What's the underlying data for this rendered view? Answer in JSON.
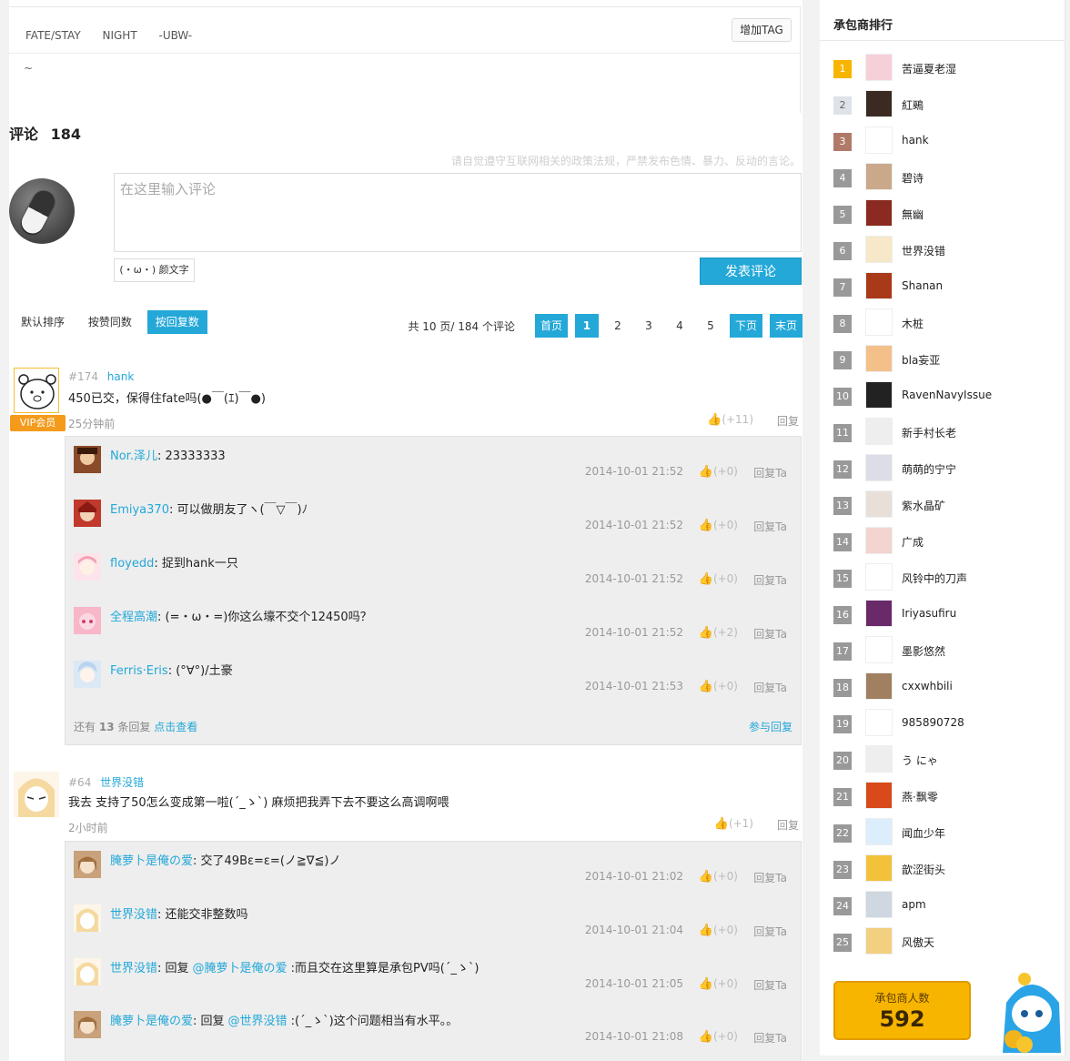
{
  "tags": [
    "FATE/STAY",
    "NIGHT",
    "-UBW-"
  ],
  "add_tag_label": "增加TAG",
  "description": "~",
  "comments_header": {
    "label": "评论",
    "count": "184"
  },
  "policy_notice": "请自觉遵守互联网相关的政策法规，严禁发布色情、暴力、反动的言论。",
  "comment_input": {
    "placeholder": "在这里输入评论"
  },
  "kaomoji_label": "(・ω・) 颜文字",
  "submit_label": "发表评论",
  "sort_tabs": [
    "默认排序",
    "按赞同数",
    "按回复数"
  ],
  "pagination": {
    "summary": "共 10 页/ 184 个评论",
    "first": "首页",
    "pages": [
      "1",
      "2",
      "3",
      "4",
      "5"
    ],
    "next": "下页",
    "last": "末页"
  },
  "comments": [
    {
      "floor": "#174",
      "user": "hank",
      "vip_label": "VIP会员",
      "text": "450已交，保得住fate吗(●￣(ｴ)￣●)",
      "time": "25分钟前",
      "likes": "(+11)",
      "reply_label": "回复",
      "replies": [
        {
          "user": "Nor.泽儿",
          "text": ": 23333333",
          "time": "2014-10-01 21:52",
          "likes": "(+0)",
          "reply_label": "回复Ta"
        },
        {
          "user": "Emiya370",
          "text": ": 可以做朋友了ヽ(￣▽￣)ﾉ",
          "time": "2014-10-01 21:52",
          "likes": "(+0)",
          "reply_label": "回复Ta"
        },
        {
          "user": "floyedd",
          "text": ": 捉到hank一只",
          "time": "2014-10-01 21:52",
          "likes": "(+0)",
          "reply_label": "回复Ta"
        },
        {
          "user": "全程高潮",
          "text": ": (=・ω・=)你这么壕不交个12450吗？",
          "time": "2014-10-01 21:52",
          "likes": "(+2)",
          "reply_label": "回复Ta"
        },
        {
          "user": "Ferris·Eris",
          "text": ": (°∀°)/土豪",
          "time": "2014-10-01 21:53",
          "likes": "(+0)",
          "reply_label": "回复Ta"
        }
      ],
      "more_prefix": "还有",
      "more_count": "13",
      "more_suffix": "条回复",
      "more_link": "点击查看",
      "join_label": "参与回复"
    },
    {
      "floor": "#64",
      "user": "世界没错",
      "text": "我去 支持了50怎么变成第一啦(´_ゝ`) 麻烦把我弄下去不要这么高调啊喂",
      "time": "2小时前",
      "likes": "(+1)",
      "reply_label": "回复",
      "replies": [
        {
          "user": "腌萝卜是俺の爱",
          "text": ": 交了49Bε=ε=(ノ≧∇≦)ノ",
          "time": "2014-10-01 21:02",
          "likes": "(+0)",
          "reply_label": "回复Ta"
        },
        {
          "user": "世界没错",
          "text": ": 还能交非整数吗",
          "time": "2014-10-01 21:04",
          "likes": "(+0)",
          "reply_label": "回复Ta"
        },
        {
          "user": "世界没错",
          "text": ": 回复",
          "mention": "@腌萝卜是俺の爱",
          "text2": " :而且交在这里算是承包PV吗(´_ゝ`)",
          "time": "2014-10-01 21:05",
          "likes": "(+0)",
          "reply_label": "回复Ta"
        },
        {
          "user": "腌萝卜是俺の爱",
          "text": ": 回复",
          "mention": "@世界没错",
          "text2": " :(´_ゝ`)这个问题相当有水平。。",
          "time": "2014-10-01 21:08",
          "likes": "(+0)",
          "reply_label": "回复Ta"
        }
      ]
    }
  ],
  "sidebar": {
    "title": "承包商排行",
    "ranking": [
      {
        "rank": "1",
        "name": "苦逼夏老湿"
      },
      {
        "rank": "2",
        "name": "紅鵐"
      },
      {
        "rank": "3",
        "name": "hank"
      },
      {
        "rank": "4",
        "name": "碧诗"
      },
      {
        "rank": "5",
        "name": "無幽"
      },
      {
        "rank": "6",
        "name": "世界没错"
      },
      {
        "rank": "7",
        "name": "Shanan"
      },
      {
        "rank": "8",
        "name": "木桩"
      },
      {
        "rank": "9",
        "name": "bla妄亚"
      },
      {
        "rank": "10",
        "name": "RavenNavyIssue"
      },
      {
        "rank": "11",
        "name": "新手村长老"
      },
      {
        "rank": "12",
        "name": "萌萌的宁宁"
      },
      {
        "rank": "13",
        "name": "紫水晶矿"
      },
      {
        "rank": "14",
        "name": "广成"
      },
      {
        "rank": "15",
        "name": "风铃中的刀声"
      },
      {
        "rank": "16",
        "name": "Iriyasufiru"
      },
      {
        "rank": "17",
        "name": "墨影悠然"
      },
      {
        "rank": "18",
        "name": "cxxwhbili"
      },
      {
        "rank": "19",
        "name": "985890728"
      },
      {
        "rank": "20",
        "name": "う にゃ"
      },
      {
        "rank": "21",
        "name": "燕·飘零"
      },
      {
        "rank": "22",
        "name": "闻血少年"
      },
      {
        "rank": "23",
        "name": "歆涩街头"
      },
      {
        "rank": "24",
        "name": "apm"
      },
      {
        "rank": "25",
        "name": "风傲天"
      }
    ],
    "sponsor_label": "承包商人数",
    "sponsor_count": "592"
  },
  "colors": {
    "accent": "#23a8d8",
    "rank_gold": "#f7b500",
    "rank_silver": "#dde3e8",
    "rank_bronze": "#b07a6a",
    "rank_default": "#999999",
    "vip": "#f49b1b"
  }
}
